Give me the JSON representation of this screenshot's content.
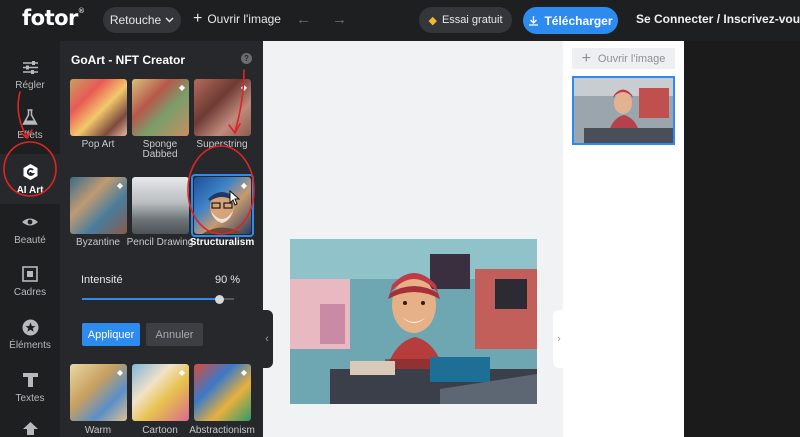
{
  "topbar": {
    "logo": "fotor",
    "logo_mark": "®",
    "retouche_label": "Retouche",
    "open_image_label": "Ouvrir l'image",
    "trial_label": "Essai gratuit",
    "download_label": "Télécharger",
    "connect_label": "Se Connecter / Inscrivez-vous"
  },
  "sidebar": {
    "items": [
      {
        "label": "Régler",
        "icon": "sliders-icon"
      },
      {
        "label": "Effets",
        "icon": "flask-icon"
      },
      {
        "label": "AI Art",
        "icon": "ai-art-icon",
        "active": true
      },
      {
        "label": "Beauté",
        "icon": "eye-icon"
      },
      {
        "label": "Cadres",
        "icon": "frame-icon"
      },
      {
        "label": "Éléments",
        "icon": "star-icon"
      },
      {
        "label": "Textes",
        "icon": "text-icon"
      }
    ]
  },
  "panel": {
    "title": "GoArt - NFT Creator",
    "help": "?",
    "styles_row1": [
      "Pop Art",
      "Sponge Dabbed",
      "Superstring"
    ],
    "styles_row2": [
      "Byzantine",
      "Pencil Drawing",
      "Structuralism"
    ],
    "styles_row3": [
      "Warm",
      "Cartoon",
      "Abstractionism"
    ],
    "selected_style": "Structuralism",
    "intensity_label": "Intensité",
    "intensity_value": "90 %",
    "intensity_fraction": 0.9,
    "apply_label": "Appliquer",
    "cancel_label": "Annuler"
  },
  "right_pane": {
    "open_image_label": "Ouvrir l'image"
  },
  "colors": {
    "accent": "#2d8bf0",
    "annotation": "#e02424",
    "premium": "#f5b82e"
  }
}
